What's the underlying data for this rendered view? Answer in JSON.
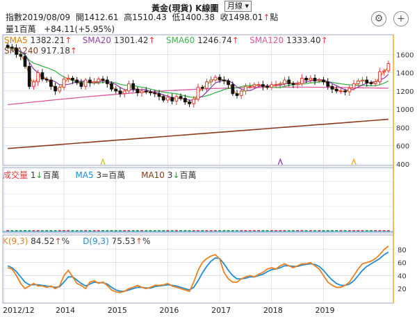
{
  "header": {
    "title": "黃金(現貨) K線圖",
    "period": "月線",
    "info_line1_label": "指數",
    "date": "2019/08/09",
    "open_label": "開",
    "open": "1412.61",
    "high_label": "高",
    "high": "1510.43",
    "low_label": "低",
    "low": "1400.38",
    "close_label": "收",
    "close": "1498.01",
    "close_unit": "點",
    "close_arrow": "↑",
    "volume_label": "量",
    "volume": "1百萬",
    "change": "+84.11(+5.95%)"
  },
  "icons": [
    "gear-icon",
    "plus-circle-icon"
  ],
  "colors": {
    "sma5": "#e67e00",
    "sma20": "#8e44ad",
    "sma60": "#39b54a",
    "sma120": "#e0589c",
    "sma240": "#8b3a1a",
    "up": "#e53935",
    "down": "#111111",
    "ma5_vol": "#1f8dd6",
    "ma10_vol": "#8b3a1a",
    "k_line": "#f07f1d",
    "d_line": "#1f8dd6",
    "grid": "#c8d3e6",
    "cursor": "#f5a623"
  },
  "legend_price": [
    {
      "label": "SMA5",
      "value": "1382.21",
      "arrow": "↑",
      "color_key": "sma5"
    },
    {
      "label": "SMA20",
      "value": "1301.42",
      "arrow": "↑",
      "color_key": "sma20"
    },
    {
      "label": "SMA60",
      "value": "1246.74",
      "arrow": "↑",
      "color_key": "sma60"
    },
    {
      "label": "SMA120",
      "value": "1333.40",
      "arrow": "↑",
      "color_key": "sma120"
    },
    {
      "label": "SMA240",
      "value": "917.18",
      "arrow": "↑",
      "color_key": "sma240"
    }
  ],
  "legend_volume": [
    {
      "label": "成交量",
      "value": "1",
      "arrow": "↓",
      "unit": "百萬",
      "color_key": "up"
    },
    {
      "label": "MA5",
      "value": "3",
      "arrow": "=",
      "unit": "百萬",
      "color_key": "ma5_vol"
    },
    {
      "label": "MA10",
      "value": "3",
      "arrow": "↓",
      "unit": "百萬",
      "color_key": "ma10_vol"
    }
  ],
  "legend_kd": [
    {
      "label": "K(9,3)",
      "value": "84.52",
      "arrow": "↑",
      "unit": "%",
      "color_key": "k_line"
    },
    {
      "label": "D(9,3)",
      "value": "75.53",
      "arrow": "↑",
      "unit": "%",
      "color_key": "d_line"
    }
  ],
  "chart_data": [
    {
      "type": "candlestick",
      "title": "黃金(現貨) K線圖",
      "x_ticks": [
        "2012/12",
        "2014",
        "2015",
        "2016",
        "2017",
        "2018",
        "2019"
      ],
      "y_ticks": [
        400,
        600,
        800,
        1000,
        1200,
        1400,
        1600
      ],
      "ylim": [
        400,
        1800
      ],
      "x_start": "2012-12",
      "close_values": [
        1680,
        1670,
        1600,
        1580,
        1470,
        1250,
        1300,
        1400,
        1330,
        1320,
        1250,
        1200,
        1240,
        1330,
        1340,
        1320,
        1290,
        1250,
        1320,
        1290,
        1300,
        1330,
        1320,
        1280,
        1220,
        1200,
        1170,
        1200,
        1280,
        1220,
        1180,
        1200,
        1190,
        1180,
        1170,
        1140,
        1100,
        1130,
        1090,
        1140,
        1120,
        1080,
        1060,
        1110,
        1240,
        1230,
        1300,
        1320,
        1350,
        1320,
        1310,
        1270,
        1170,
        1150,
        1200,
        1250,
        1250,
        1270,
        1270,
        1250,
        1240,
        1270,
        1270,
        1280,
        1320,
        1280,
        1270,
        1280,
        1340,
        1320,
        1340,
        1310,
        1320,
        1300,
        1250,
        1220,
        1200,
        1200,
        1190,
        1230,
        1280,
        1310,
        1320,
        1290,
        1280,
        1300,
        1410,
        1420,
        1500
      ],
      "sma240_range": [
        570,
        890
      ],
      "markers_months": [
        22,
        63,
        80
      ]
    },
    {
      "type": "bar",
      "title": "成交量",
      "values_note": "near-zero monthly volume bars",
      "ylim": [
        0,
        10
      ]
    },
    {
      "type": "line",
      "title": "KD",
      "y_ticks": [
        20,
        40,
        60,
        80
      ],
      "ylim": [
        0,
        100
      ],
      "series": [
        {
          "name": "K(9,3)",
          "values": [
            52,
            50,
            40,
            28,
            20,
            24,
            28,
            24,
            24,
            22,
            24,
            20,
            24,
            40,
            48,
            38,
            28,
            25,
            20,
            30,
            32,
            28,
            30,
            25,
            18,
            15,
            14,
            16,
            20,
            22,
            25,
            22,
            20,
            22,
            25,
            25,
            26,
            28,
            24,
            22,
            20,
            18,
            16,
            30,
            48,
            60,
            66,
            70,
            72,
            65,
            45,
            35,
            30,
            30,
            35,
            38,
            40,
            38,
            42,
            45,
            50,
            52,
            50,
            55,
            58,
            55,
            52,
            55,
            58,
            58,
            60,
            55,
            50,
            40,
            30,
            25,
            22,
            22,
            25,
            30,
            40,
            50,
            58,
            60,
            62,
            66,
            72,
            80,
            85
          ]
        },
        {
          "name": "D(9,3)",
          "values": [
            55,
            52,
            46,
            38,
            30,
            26,
            26,
            26,
            25,
            24,
            23,
            22,
            23,
            30,
            38,
            38,
            33,
            28,
            24,
            27,
            30,
            29,
            29,
            27,
            22,
            18,
            16,
            16,
            18,
            20,
            22,
            22,
            21,
            21,
            23,
            24,
            25,
            26,
            25,
            24,
            22,
            20,
            18,
            22,
            32,
            44,
            54,
            62,
            67,
            66,
            58,
            48,
            40,
            35,
            35,
            36,
            38,
            38,
            40,
            42,
            46,
            49,
            50,
            52,
            55,
            55,
            54,
            54,
            56,
            57,
            58,
            57,
            54,
            48,
            40,
            33,
            28,
            25,
            25,
            27,
            32,
            40,
            48,
            54,
            58,
            62,
            66,
            72,
            76
          ]
        }
      ]
    }
  ]
}
